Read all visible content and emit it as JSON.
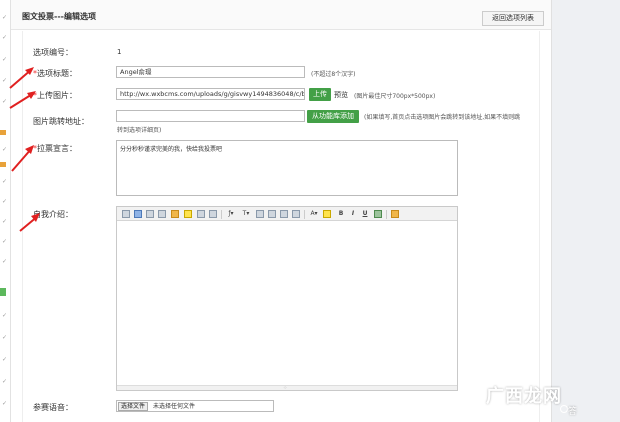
{
  "header": {
    "title": "图文投票---编辑选项",
    "back_button": "返回选项列表"
  },
  "form": {
    "option_no": {
      "label": "选项编号：",
      "value": "1"
    },
    "option_title": {
      "required": "*",
      "label": "选项标题：",
      "value": "Angel俞璟",
      "hint": "(不超过8个汉字)"
    },
    "upload_image": {
      "required": "*",
      "label": "上传图片：",
      "value": "http://wx.wxbcms.com/uploads/g/gisvwy1494836048/c/b/a/...",
      "upload_button": "上传",
      "preview_link": "预览",
      "hint": "(图片最佳尺寸700px*500px)"
    },
    "jump_url": {
      "label": "图片跳转地址：",
      "value": "",
      "library_button": "从功能库添加",
      "hint_line1": "(如果填写,首页点击选项图片会跳转到该地址,如果不填则跳",
      "hint_line2": "转到选项详细页)"
    },
    "slogan": {
      "required": "*",
      "label": "拉票宣言：",
      "value": "分分秒秒谨求完美的我，快给我投票吧"
    },
    "intro": {
      "label": "自我介绍："
    },
    "voice": {
      "label": "参赛语音：",
      "choose_button": "选择文件",
      "no_file": "未选择任何文件"
    }
  },
  "editor_toolbar": [
    "source-icon",
    "undo-icon",
    "paste-icon",
    "paste-text-icon",
    "format-painter-icon",
    "emoticon-icon",
    "cursor-icon",
    "link-icon",
    "font-family-icon",
    "font-size-icon",
    "subscript-icon",
    "superscript-icon",
    "indent-icon",
    "outdent-icon",
    "font-color-icon",
    "highlight-icon",
    "bold-icon",
    "italic-icon",
    "underline-icon",
    "strike-icon",
    "table-icon"
  ],
  "toolbar_glyphs": {
    "font_family": "ƒ▾",
    "font_size": "T▾",
    "font_color": "A▾",
    "bold": "B",
    "italic": "I",
    "underline": "U"
  },
  "watermark": {
    "main": "广西龙网",
    "sub": "答"
  },
  "colors": {
    "required": "#ee3333",
    "button_green": "#43a047",
    "arrow_red": "#e02020"
  }
}
